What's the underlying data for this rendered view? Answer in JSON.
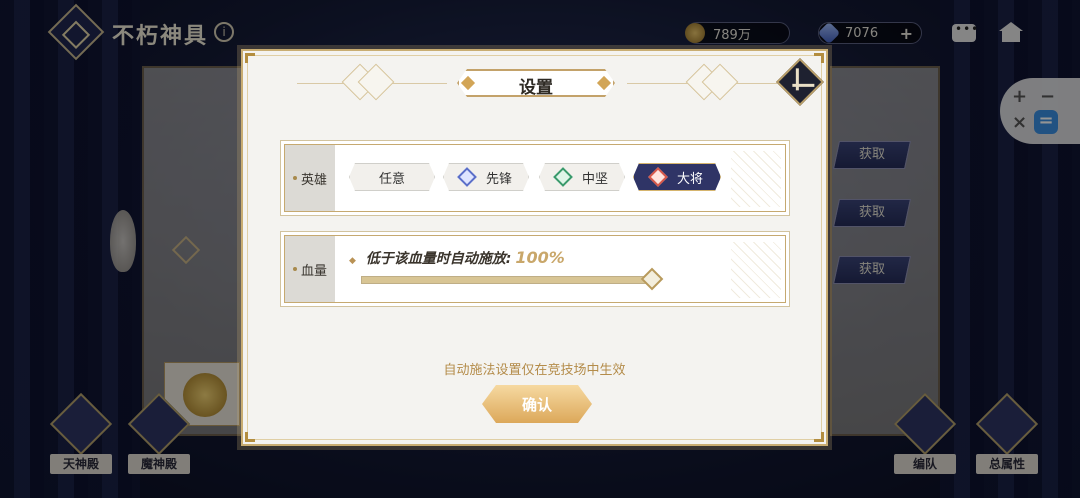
{
  "header": {
    "title": "不朽神具",
    "gold_amount": "789万",
    "gem_amount": "7076",
    "gem_plus": "+"
  },
  "side_buttons": {
    "get_label": "获取"
  },
  "dock": {
    "left": [
      "天神殿",
      "魔神殿"
    ],
    "right": [
      "编队",
      "总属性"
    ]
  },
  "floating_widget": {
    "keys": [
      "+",
      "−",
      "×",
      "="
    ]
  },
  "dialog": {
    "title": "设置",
    "hero_row": {
      "label": "英雄",
      "options": [
        "任意",
        "先锋",
        "中坚",
        "大将"
      ],
      "selected": "大将"
    },
    "hp_row": {
      "label": "血量",
      "description": "低于该血量时自动施放:",
      "value": "100%",
      "slider_fraction": 1.0
    },
    "notice": "自动施法设置仅在竞技场中生效",
    "confirm_label": "确认"
  },
  "colors": {
    "accent_gold": "#c9ad72",
    "selected_option": "#2f3466",
    "confirm_button": "#dca85a"
  }
}
